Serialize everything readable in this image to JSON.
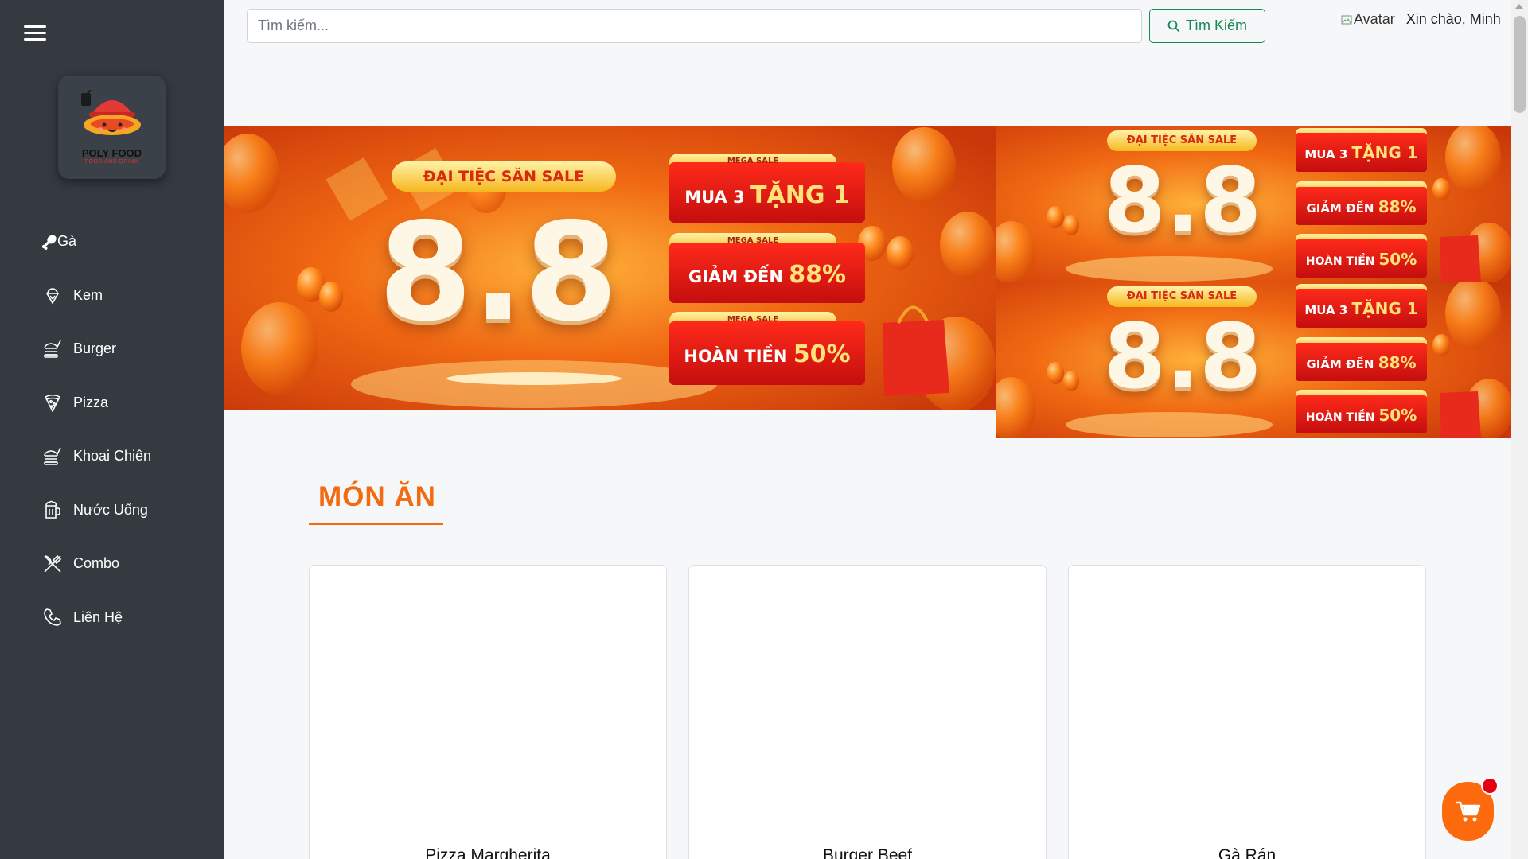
{
  "sidebar": {
    "logo": {
      "name": "POLY FOOD",
      "tagline": "FOOD AND DRINK"
    },
    "items": [
      {
        "label": "Gà",
        "icon": "chicken-drumstick-icon"
      },
      {
        "label": "Kem",
        "icon": "ice-cream-icon"
      },
      {
        "label": "Burger",
        "icon": "burger-icon"
      },
      {
        "label": "Pizza",
        "icon": "pizza-icon"
      },
      {
        "label": "Khoai Chiên",
        "icon": "fries-icon"
      },
      {
        "label": "Nước Uống",
        "icon": "beer-mug-icon"
      },
      {
        "label": "Combo",
        "icon": "utensils-icon"
      },
      {
        "label": "Liên Hệ",
        "icon": "phone-icon"
      }
    ]
  },
  "header": {
    "search_placeholder": "Tìm kiếm...",
    "search_button": "Tìm Kiếm",
    "avatar_alt": "Avatar",
    "greeting": "Xin chào, Minh"
  },
  "banners": {
    "title": "ĐẠI TIỆC SĂN SALE",
    "big": "8.8",
    "tag": "MEGA SALE",
    "offers": [
      {
        "prefix": "MUA 3",
        "highlight": "TẶNG 1"
      },
      {
        "prefix": "GIẢM ĐẾN",
        "highlight": "88%"
      },
      {
        "prefix": "HOÀN TIỀN",
        "highlight": "50%"
      }
    ]
  },
  "section": {
    "title": "MÓN ĂN"
  },
  "products": [
    {
      "name": "Pizza Margherita"
    },
    {
      "name": "Burger Beef"
    },
    {
      "name": "Gà Rán"
    }
  ],
  "colors": {
    "sidebar": "#343a40",
    "accent": "#f26a11",
    "search": "#198754",
    "cart": "#fd6a0e",
    "badge": "#e60012"
  }
}
